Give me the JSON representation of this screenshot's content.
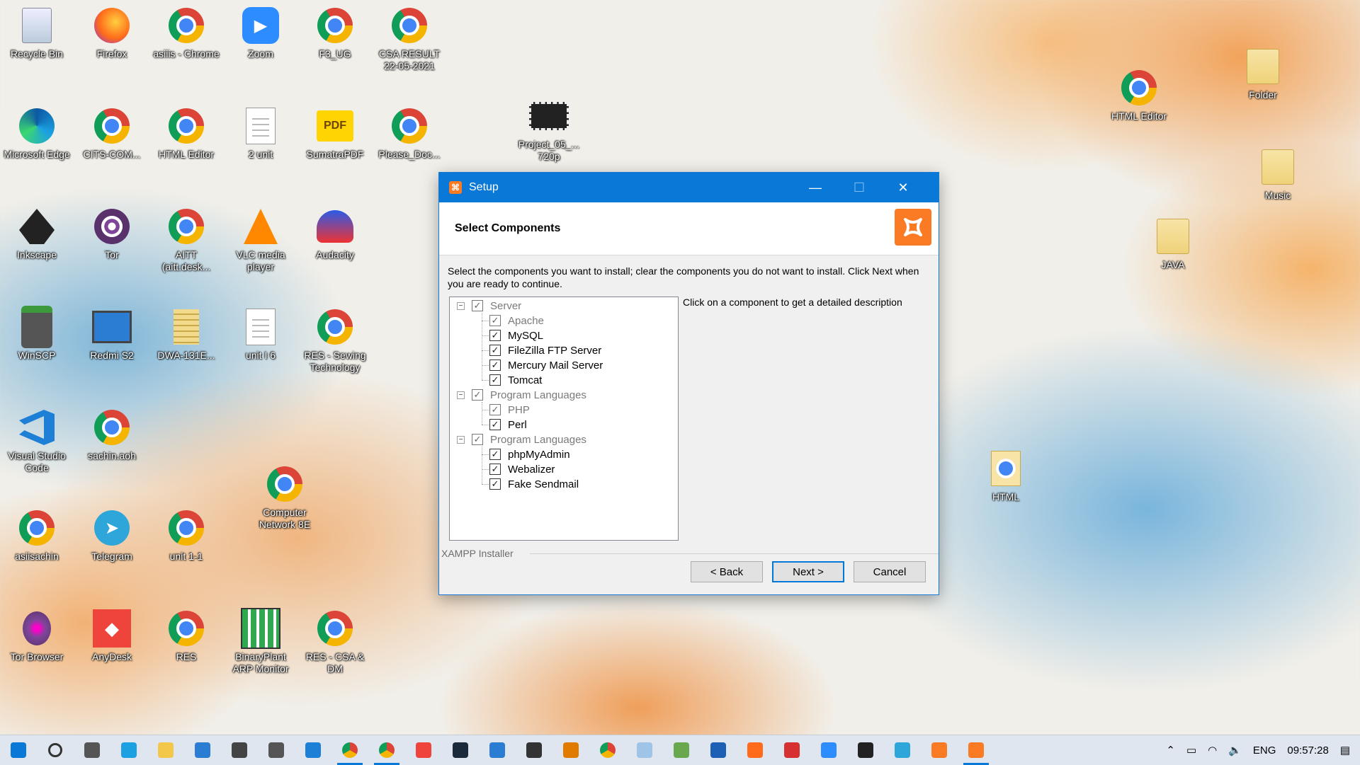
{
  "desktop": {
    "icons": [
      {
        "label": "Recycle Bin",
        "icon": "recycle-bin-icon"
      },
      {
        "label": "Firefox",
        "icon": "firefox-icon"
      },
      {
        "label": "asiiis - Chrome",
        "icon": "chrome-icon"
      },
      {
        "label": "Zoom",
        "icon": "zoom-icon"
      },
      {
        "label": "F3_UG",
        "icon": "chrome-icon"
      },
      {
        "label": "CSA RESULT 22-05-2021",
        "icon": "chrome-icon"
      },
      {
        "label": "Microsoft Edge",
        "icon": "edge-icon"
      },
      {
        "label": "CITS-COM...",
        "icon": "chrome-icon"
      },
      {
        "label": "HTML Editor",
        "icon": "chrome-icon"
      },
      {
        "label": "2 unit",
        "icon": "document-icon"
      },
      {
        "label": "SumatraPDF",
        "icon": "pdf-icon"
      },
      {
        "label": "Please_Doc...",
        "icon": "chrome-icon"
      },
      {
        "label": "Project_05_... 720p",
        "icon": "video-icon"
      },
      {
        "label": "Inkscape",
        "icon": "inkscape-icon"
      },
      {
        "label": "Tor",
        "icon": "tor-icon"
      },
      {
        "label": "AITT (aitt.desk...",
        "icon": "chrome-icon"
      },
      {
        "label": "VLC media player",
        "icon": "vlc-icon"
      },
      {
        "label": "Audacity",
        "icon": "audacity-icon"
      },
      {
        "label": "WinSCP",
        "icon": "winscp-icon"
      },
      {
        "label": "Redmi S2",
        "icon": "computer-icon"
      },
      {
        "label": "DWA-131E...",
        "icon": "zip-folder-icon"
      },
      {
        "label": "unit I 6",
        "icon": "document-icon"
      },
      {
        "label": "RES - Sewing Technology",
        "icon": "chrome-icon"
      },
      {
        "label": "Visual Studio Code",
        "icon": "vscode-icon"
      },
      {
        "label": "sachin.aoh",
        "icon": "chrome-icon"
      },
      {
        "label": "Computer Network 8E",
        "icon": "chrome-icon"
      },
      {
        "label": "asiisachin",
        "icon": "chrome-icon"
      },
      {
        "label": "Telegram",
        "icon": "telegram-icon"
      },
      {
        "label": "unit 1-1",
        "icon": "chrome-icon"
      },
      {
        "label": "Tor Browser",
        "icon": "tor-browser-icon"
      },
      {
        "label": "AnyDesk",
        "icon": "anydesk-icon"
      },
      {
        "label": "RES",
        "icon": "chrome-icon"
      },
      {
        "label": "BinaryPlant ARP Monitor",
        "icon": "arp-monitor-icon"
      },
      {
        "label": "RES - CSA & DM",
        "icon": "chrome-icon"
      },
      {
        "label": "HTML Editor",
        "icon": "chrome-icon"
      },
      {
        "label": "Folder",
        "icon": "folder-icon"
      },
      {
        "label": "Music",
        "icon": "folder-icon"
      },
      {
        "label": "JAVA",
        "icon": "folder-icon"
      },
      {
        "label": "HTML",
        "icon": "chrome-file-icon"
      }
    ]
  },
  "setup": {
    "window_title": "Setup",
    "header_title": "Select Components",
    "intro": "Select the components you want to install; clear the components you do not want to install. Click Next when you are ready to continue.",
    "description_hint": "Click on a component to get a detailed description",
    "tree": [
      {
        "label": "Server",
        "level": 0,
        "checked": true,
        "dim": true
      },
      {
        "label": "Apache",
        "level": 1,
        "checked": true,
        "dim": true
      },
      {
        "label": "MySQL",
        "level": 1,
        "checked": true,
        "dim": false
      },
      {
        "label": "FileZilla FTP Server",
        "level": 1,
        "checked": true,
        "dim": false
      },
      {
        "label": "Mercury Mail Server",
        "level": 1,
        "checked": true,
        "dim": false
      },
      {
        "label": "Tomcat",
        "level": 1,
        "checked": true,
        "dim": false
      },
      {
        "label": "Program Languages",
        "level": 0,
        "checked": true,
        "dim": true
      },
      {
        "label": "PHP",
        "level": 1,
        "checked": true,
        "dim": true
      },
      {
        "label": "Perl",
        "level": 1,
        "checked": true,
        "dim": false
      },
      {
        "label": "Program Languages",
        "level": 0,
        "checked": true,
        "dim": true
      },
      {
        "label": "phpMyAdmin",
        "level": 1,
        "checked": true,
        "dim": false
      },
      {
        "label": "Webalizer",
        "level": 1,
        "checked": true,
        "dim": false
      },
      {
        "label": "Fake Sendmail",
        "level": 1,
        "checked": true,
        "dim": false
      }
    ],
    "group_label": "XAMPP Installer",
    "buttons": {
      "back": "< Back",
      "next": "Next >",
      "cancel": "Cancel"
    }
  },
  "taskbar": {
    "items": [
      "start-icon",
      "search-icon",
      "camera-icon",
      "edge-icon",
      "file-explorer-icon",
      "calculator-icon",
      "mail-icon",
      "settings-icon",
      "vscode-icon",
      "chrome-icon",
      "chrome-icon",
      "anydesk-icon",
      "terminal-icon",
      "phone-icon",
      "store-icon",
      "target-icon",
      "chrome-icon",
      "notepad-icon",
      "task-manager-icon",
      "inkscape-icon",
      "firefox-icon",
      "g-icon",
      "zoom-icon",
      "obs-icon",
      "telegram-icon",
      "xampp-icon",
      "xampp-icon"
    ],
    "language": "ENG",
    "time": "09:57:28"
  },
  "colors": {
    "accent": "#0a78d7",
    "xampp": "#fb7a24"
  }
}
